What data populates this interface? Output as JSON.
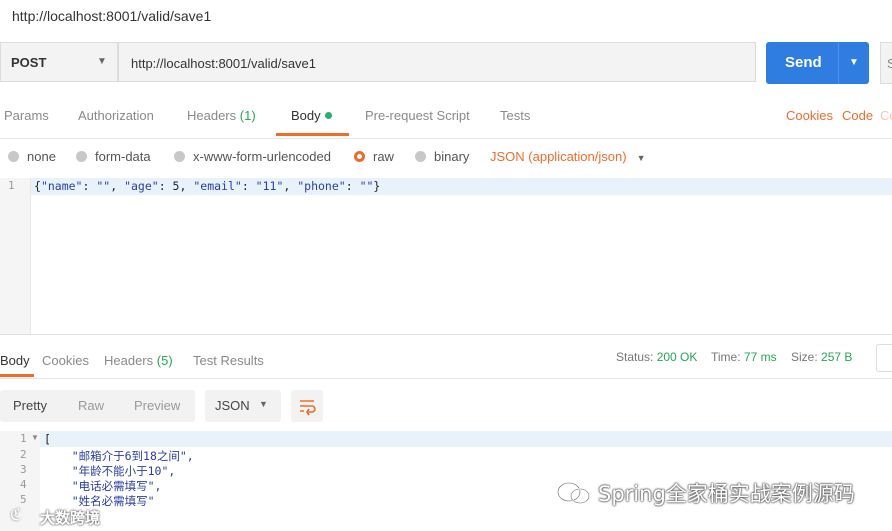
{
  "title": "http://localhost:8001/valid/save1",
  "request": {
    "method": "POST",
    "url": "http://localhost:8001/valid/save1",
    "send_label": "Send",
    "save_label": "S"
  },
  "req_tabs": {
    "params": "Params",
    "authorization": "Authorization",
    "headers": "Headers",
    "headers_count": "(1)",
    "body": "Body",
    "prerequest": "Pre-request Script",
    "tests": "Tests",
    "cookies": "Cookies",
    "code": "Code",
    "extra": "Co"
  },
  "body_modes": {
    "none": "none",
    "form_data": "form-data",
    "urlencoded": "x-www-form-urlencoded",
    "raw": "raw",
    "binary": "binary",
    "content_type": "JSON (application/json)"
  },
  "editor": {
    "line_number": "1",
    "code_open": "{",
    "k_name": "\"name\"",
    "v_name": "\"\"",
    "k_age": "\"age\"",
    "v_age": "5",
    "k_email": "\"email\"",
    "v_email": "\"11\"",
    "k_phone": "\"phone\"",
    "v_phone": "\"\"",
    "code_close": "}"
  },
  "resp_tabs": {
    "body": "Body",
    "cookies": "Cookies",
    "headers": "Headers",
    "headers_count": "(5)",
    "test_results": "Test Results"
  },
  "status": {
    "status_label": "Status:",
    "status_value": "200 OK",
    "time_label": "Time:",
    "time_value": "77 ms",
    "size_label": "Size:",
    "size_value": "257 B"
  },
  "view": {
    "pretty": "Pretty",
    "raw": "Raw",
    "preview": "Preview",
    "format": "JSON"
  },
  "response": {
    "lines": [
      {
        "num": "1",
        "text": "["
      },
      {
        "num": "2",
        "text": "    \"邮箱介于6到18之间\","
      },
      {
        "num": "3",
        "text": "    \"年龄不能小于10\","
      },
      {
        "num": "4",
        "text": "    \"电话必需填写\","
      },
      {
        "num": "5",
        "text": "    \"姓名必需填写\""
      }
    ]
  },
  "watermarks": {
    "main": "Spring全家桶实战案例源码",
    "corner": "大数跨境"
  },
  "colors": {
    "accent": "#f06c2b",
    "send": "#2f7de1",
    "success": "#26a65b"
  }
}
